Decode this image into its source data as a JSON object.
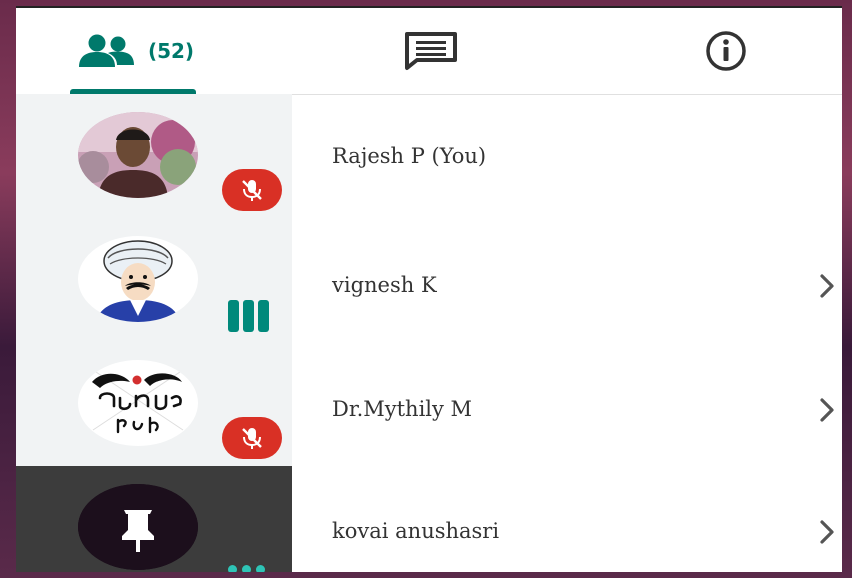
{
  "tabs": {
    "people_count": "(52)",
    "people_icon": "people-icon",
    "chat_icon": "chat-icon",
    "info_icon": "info-icon"
  },
  "participants": [
    {
      "name": "Rajesh P (You)",
      "status": "muted",
      "has_chevron": false
    },
    {
      "name": "vignesh K",
      "status": "speaking",
      "has_chevron": true
    },
    {
      "name": "Dr.Mythily M",
      "status": "muted",
      "has_chevron": true
    },
    {
      "name": "kovai anushasri",
      "status": "more",
      "has_chevron": true
    }
  ],
  "colors": {
    "accent": "#00796b",
    "mute_red": "#d93025",
    "speaking_teal": "#00897b",
    "dots_teal": "#2ec4b6"
  }
}
